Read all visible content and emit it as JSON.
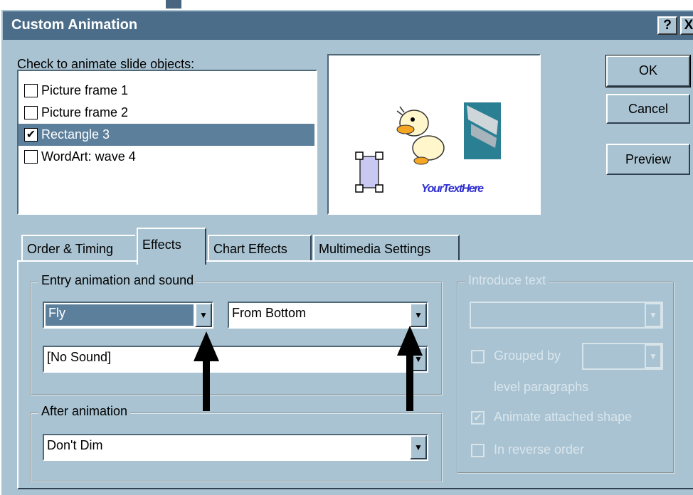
{
  "window": {
    "title": "Custom Animation",
    "help_label": "?",
    "close_label": "X"
  },
  "objects": {
    "label": "Check to animate slide objects:",
    "items": [
      {
        "label": "Picture frame 1",
        "checked": false
      },
      {
        "label": "Picture frame 2",
        "checked": false
      },
      {
        "label": "Rectangle 3",
        "checked": true
      },
      {
        "label": "WordArt: wave 4",
        "checked": false
      }
    ]
  },
  "buttons": {
    "ok": "OK",
    "cancel": "Cancel",
    "preview": "Preview"
  },
  "tabs": [
    {
      "label": "Order & Timing"
    },
    {
      "label": "Effects"
    },
    {
      "label": "Chart Effects"
    },
    {
      "label": "Multimedia Settings"
    }
  ],
  "entry": {
    "title": "Entry animation and sound",
    "effect": "Fly",
    "direction": "From Bottom",
    "sound": "[No Sound]"
  },
  "after": {
    "title": "After animation",
    "value": "Don't Dim"
  },
  "introduce": {
    "title": "Introduce text",
    "grouped_label": "Grouped by",
    "level_label": "level paragraphs",
    "animate_attached": "Animate attached shape",
    "reverse_order": "In reverse order"
  },
  "preview_image": {
    "wordart_text": "YourTextHere"
  }
}
